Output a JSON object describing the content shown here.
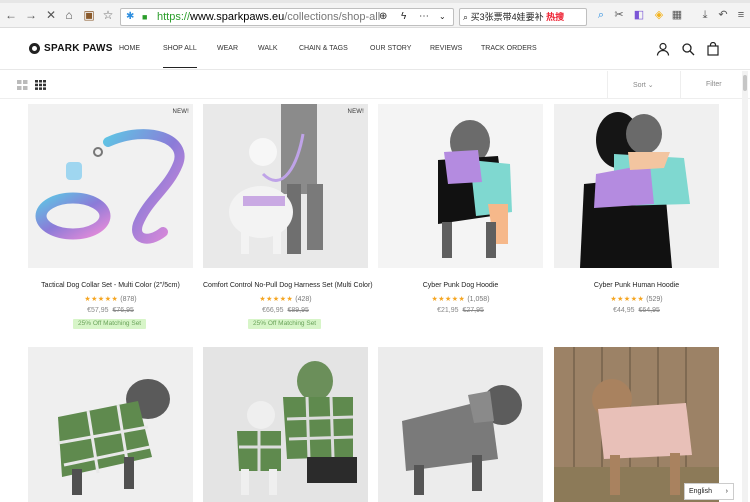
{
  "browser": {
    "url_scheme": "https://",
    "url_host": "www.sparkpaws.eu",
    "url_path": "/collections/shop-all",
    "search_text": "买3张票带4娃要补",
    "search_hot": "热搜"
  },
  "header": {
    "logo": "SPARK PAWS",
    "nav": [
      "HOME",
      "SHOP ALL",
      "WEAR",
      "WALK",
      "CHAIN & TAGS",
      "OUR STORY",
      "REVIEWS",
      "TRACK ORDERS"
    ],
    "active_nav": "SHOP ALL"
  },
  "toolbar": {
    "sort": "Sort",
    "filter": "Filter"
  },
  "products": [
    {
      "title": "Tactical Dog Collar Set - Multi Color (2\"/5cm)",
      "badge": "NEW!",
      "stars": "★★★★★",
      "count": "(878)",
      "price": "€57,95",
      "old_price": "€76,95",
      "promo": "25% Off Matching Set"
    },
    {
      "title": "Comfort Control No-Pull Dog Harness Set (Multi Color)",
      "badge": "NEW!",
      "stars": "★★★★★",
      "count": "(428)",
      "price": "€66,95",
      "old_price": "€89,95",
      "promo": "25% Off Matching Set"
    },
    {
      "title": "Cyber Punk Dog Hoodie",
      "badge": "",
      "stars": "★★★★★",
      "count": "(1,058)",
      "price": "€21,95",
      "old_price": "€27,95",
      "promo": ""
    },
    {
      "title": "Cyber Punk Human Hoodie",
      "badge": "",
      "stars": "★★★★★",
      "count": "(529)",
      "price": "€44,95",
      "old_price": "€64,95",
      "promo": ""
    }
  ],
  "language": "English",
  "colors": {
    "star": "#f5a623",
    "promo_bg": "#d7f5c8",
    "promo_text": "#6aa35a",
    "secure": "#2a9d2a"
  }
}
